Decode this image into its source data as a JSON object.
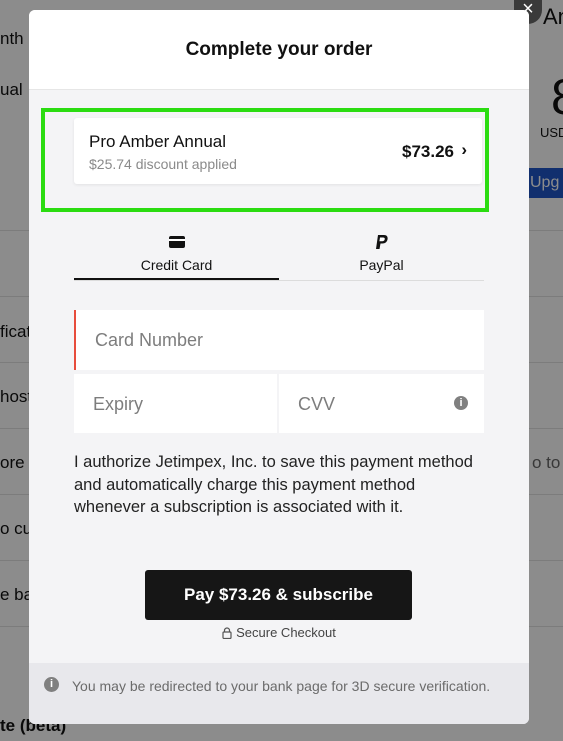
{
  "background": {
    "left_fragments": [
      "nth",
      "ual",
      "ficat",
      "host",
      "ore",
      "o cu",
      "e ba",
      "te (beta)"
    ],
    "right_fragments": {
      "title": "An",
      "big_number": "8",
      "currency": "USD",
      "upgrade": "Upg",
      "side_text": "o to"
    }
  },
  "close_label": "×",
  "modal": {
    "title": "Complete your order",
    "plan": {
      "name": "Pro Amber Annual",
      "discount": "$25.74 discount applied",
      "price": "$73.26",
      "chevron": "›"
    },
    "tabs": [
      {
        "label": "Credit Card",
        "icon": "credit-card-icon",
        "active": true
      },
      {
        "label": "PayPal",
        "icon": "paypal-icon",
        "active": false
      }
    ],
    "fields": {
      "card_number_placeholder": "Card Number",
      "expiry_placeholder": "Expiry",
      "cvv_placeholder": "CVV"
    },
    "authorize_text": "I authorize Jetimpex, Inc. to save this payment method and automatically charge this payment method whenever a subscription is associated with it.",
    "pay_button": "Pay $73.26 & subscribe",
    "secure_label": "Secure Checkout",
    "footer_note": "You may be redirected to your bank page for 3D secure verification."
  },
  "colors": {
    "highlight": "#2bdc11",
    "pay_button_bg": "#161616",
    "card_number_error_border": "#e74c3c",
    "upgrade_bg": "#1f56c9"
  }
}
